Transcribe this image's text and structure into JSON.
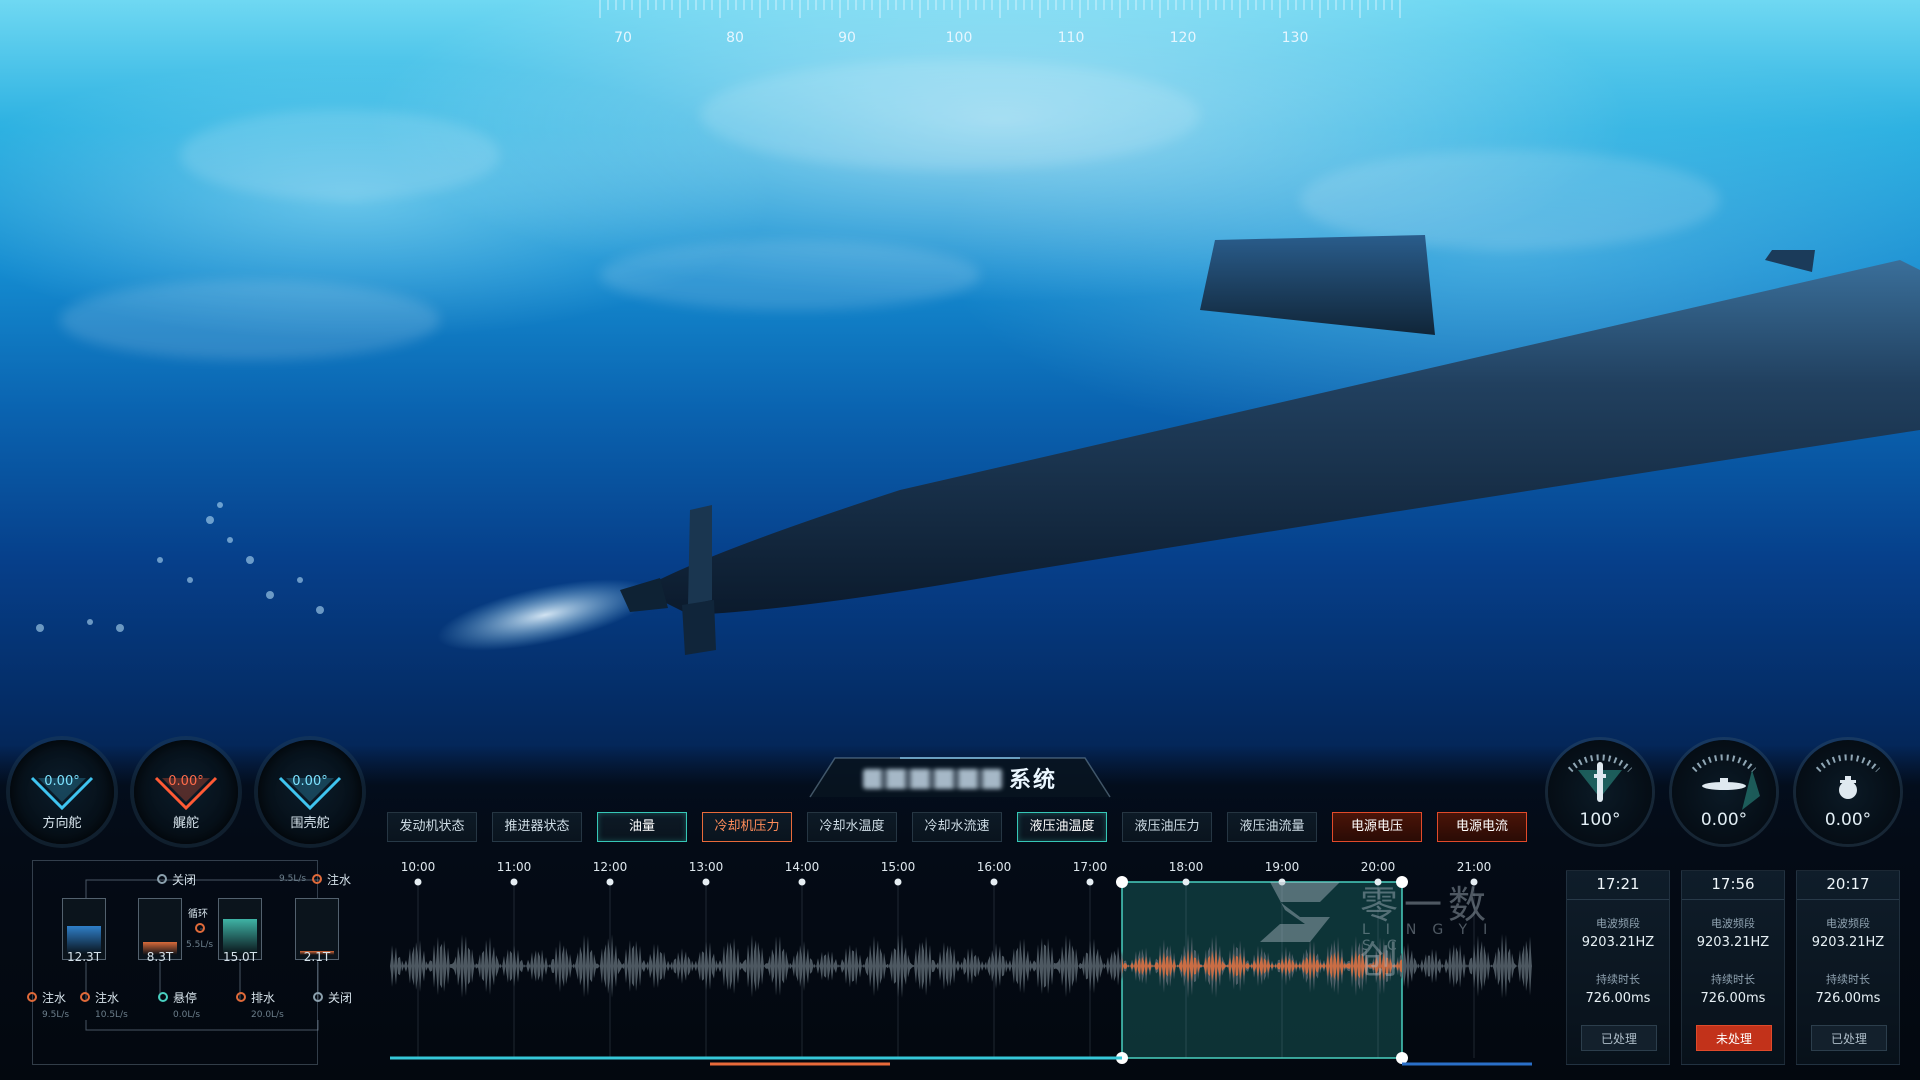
{
  "ruler": {
    "labels": [
      "70",
      "80",
      "90",
      "100",
      "110",
      "120",
      "130"
    ]
  },
  "title": {
    "suffix": "系统"
  },
  "left_gauges": [
    {
      "value": "0.00°",
      "label": "方向舵",
      "color": "#3fc4f0"
    },
    {
      "value": "0.00°",
      "label": "艉舵",
      "color": "#ff5a35"
    },
    {
      "value": "0.00°",
      "label": "围壳舵",
      "color": "#3fc4f0"
    }
  ],
  "right_gauges": [
    {
      "icon": "submarine-top-icon",
      "value": "100°"
    },
    {
      "icon": "submarine-side-icon",
      "value": "0.00°"
    },
    {
      "icon": "submarine-front-icon",
      "value": "0.00°"
    }
  ],
  "tabs": [
    {
      "label": "发动机状态",
      "style": "default"
    },
    {
      "label": "推进器状态",
      "style": "default"
    },
    {
      "label": "油量",
      "style": "cyan"
    },
    {
      "label": "冷却机压力",
      "style": "orange"
    },
    {
      "label": "冷却水温度",
      "style": "default"
    },
    {
      "label": "冷却水流速",
      "style": "default"
    },
    {
      "label": "液压油温度",
      "style": "cyan"
    },
    {
      "label": "液压油压力",
      "style": "default"
    },
    {
      "label": "液压油流量",
      "style": "default"
    },
    {
      "label": "电源电压",
      "style": "red"
    },
    {
      "label": "电源电流",
      "style": "red"
    }
  ],
  "timeline": {
    "ticks": [
      "10:00",
      "11:00",
      "12:00",
      "13:00",
      "14:00",
      "15:00",
      "16:00",
      "17:00",
      "18:00",
      "19:00",
      "20:00",
      "21:00"
    ],
    "selection": {
      "start": "17:20",
      "end": "20:15"
    }
  },
  "ballast": {
    "top_left": {
      "label": "关闭"
    },
    "top_right": {
      "label": "注水",
      "rate": "9.5L/s"
    },
    "loop": {
      "label": "循环",
      "rate": "5.5L/s"
    },
    "tanks": [
      {
        "value": "12.3T",
        "level": 0.55,
        "color": "#2f7fc8"
      },
      {
        "value": "8.3T",
        "level": 0.25,
        "color": "#d86a3a"
      },
      {
        "value": "15.0T",
        "level": 0.7,
        "color": "#3fb3a5"
      },
      {
        "value": "2.1T",
        "level": 0.08,
        "color": "#d86a3a"
      }
    ],
    "controls": [
      {
        "label": "注水",
        "rate": "9.5L/s",
        "state": "orange"
      },
      {
        "label": "注水",
        "rate": "10.5L/s",
        "state": "orange"
      },
      {
        "label": "悬停",
        "rate": "0.0L/s",
        "state": "cyan"
      },
      {
        "label": "排水",
        "rate": "20.0L/s",
        "state": "orange"
      },
      {
        "label": "关闭",
        "rate": "",
        "state": "gray"
      }
    ]
  },
  "events": [
    {
      "time": "17:21",
      "freq_label": "电波频段",
      "freq": "9203.21HZ",
      "dur_label": "持续时长",
      "dur": "726.00ms",
      "status": "已处理",
      "alert": false
    },
    {
      "time": "17:56",
      "freq_label": "电波频段",
      "freq": "9203.21HZ",
      "dur_label": "持续时长",
      "dur": "726.00ms",
      "status": "未处理",
      "alert": true
    },
    {
      "time": "20:17",
      "freq_label": "电波频段",
      "freq": "9203.21HZ",
      "dur_label": "持续时长",
      "dur": "726.00ms",
      "status": "已处理",
      "alert": false
    }
  ],
  "watermark": {
    "cn": "零一数创",
    "en": "LINGYI SC"
  },
  "colors": {
    "cyan": "#36c7b7",
    "orange": "#e86a3a",
    "red": "#c2321a"
  }
}
